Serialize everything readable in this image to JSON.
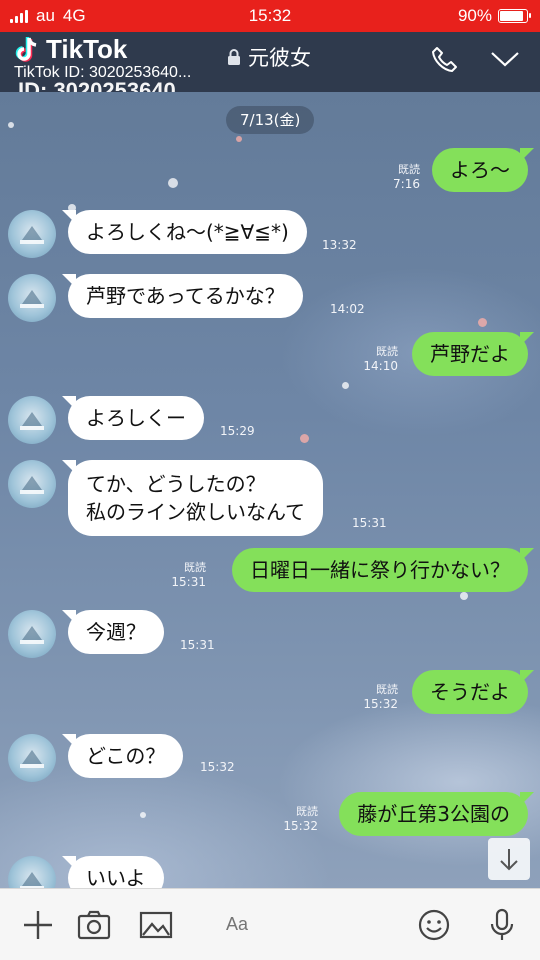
{
  "status_bar": {
    "carrier": "au",
    "network": "4G",
    "time": "15:32",
    "battery": "90%",
    "battery_level": 0.9
  },
  "header": {
    "tiktok_brand": "TikTok",
    "tiktok_id_small": "TikTok ID: 3020253640...",
    "tiktok_id_large": "ID: 3020253640...",
    "contact_name": "元彼女",
    "icons": [
      "lock-icon",
      "phone-icon",
      "chevron-down-icon"
    ]
  },
  "chat": {
    "date_label": "7/13(金)",
    "read_label": "既読",
    "messages": [
      {
        "dir": "out",
        "text": "よろ〜",
        "time": "7:16",
        "read": true
      },
      {
        "dir": "in",
        "text": "よろしくね〜(*≧∀≦*)",
        "time": "13:32"
      },
      {
        "dir": "in",
        "text": "芦野であってるかな？",
        "time": "14:02"
      },
      {
        "dir": "out",
        "text": "芦野だよ",
        "time": "14:10",
        "read": true
      },
      {
        "dir": "in",
        "text": "よろしくー",
        "time": "15:29"
      },
      {
        "dir": "in",
        "text": "てか、どうしたの？",
        "text2": "私のライン欲しいなんて",
        "time": "15:31"
      },
      {
        "dir": "out",
        "text": "日曜日一緒に祭り行かない？",
        "time": "15:31",
        "read": true
      },
      {
        "dir": "in",
        "text": "今週？",
        "time": "15:31"
      },
      {
        "dir": "out",
        "text": "そうだよ",
        "time": "15:32",
        "read": true
      },
      {
        "dir": "in",
        "text": "どこの？",
        "time": "15:32"
      },
      {
        "dir": "out",
        "text": "藤が丘第3公園の",
        "time": "15:32",
        "read": true
      },
      {
        "dir": "in",
        "text": "いいよ",
        "time": ""
      }
    ]
  },
  "input_bar": {
    "placeholder": "Aa",
    "icons": [
      "plus-icon",
      "camera-icon",
      "image-icon",
      "emoji-icon",
      "microphone-icon"
    ]
  }
}
